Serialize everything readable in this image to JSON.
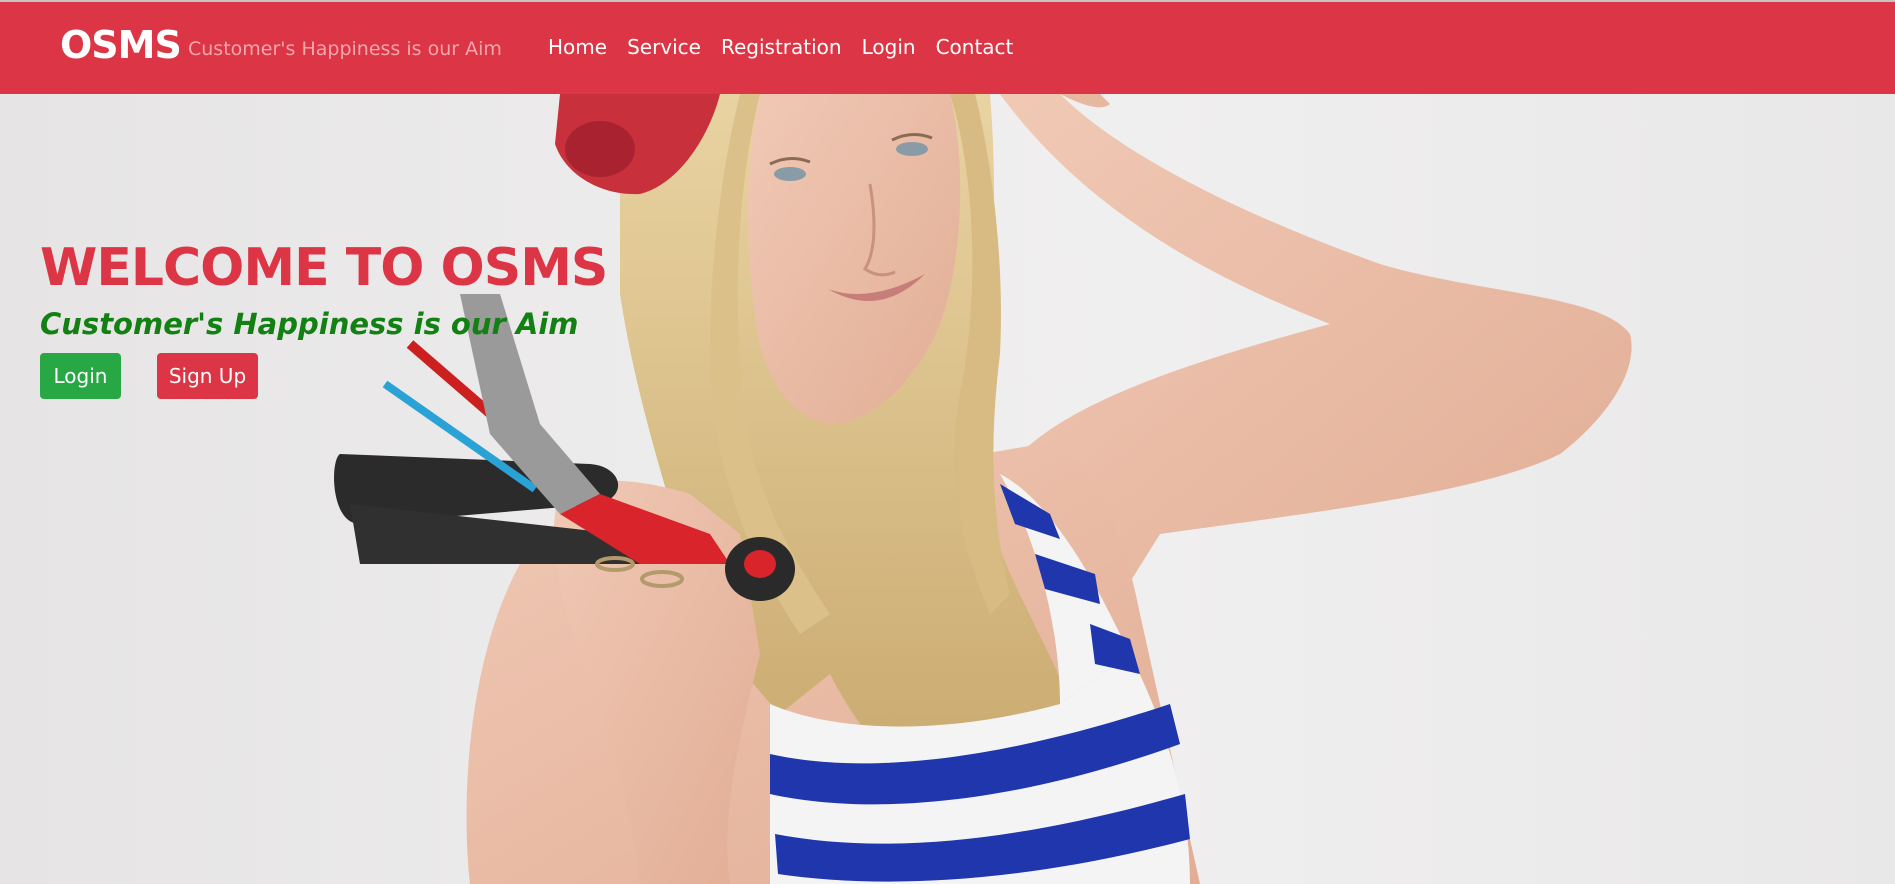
{
  "navbar": {
    "brand": "OSMS",
    "tagline": "Customer's Happiness is our Aim",
    "links": [
      {
        "label": "Home"
      },
      {
        "label": "Service"
      },
      {
        "label": "Registration"
      },
      {
        "label": "Login"
      },
      {
        "label": "Contact"
      }
    ]
  },
  "hero": {
    "title": "WELCOME TO OSMS",
    "subtitle": "Customer's Happiness is our Aim",
    "login_label": "Login",
    "signup_label": "Sign Up"
  },
  "colors": {
    "primary_red": "#dc3545",
    "success_green": "#28a745",
    "subtitle_green": "#128012"
  }
}
